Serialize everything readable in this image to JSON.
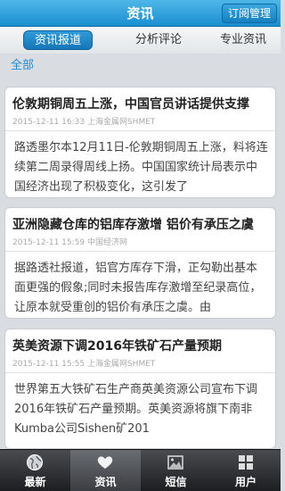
{
  "header": {
    "title": "资讯",
    "subscribe_label": "订阅管理"
  },
  "tabs": [
    {
      "label": "资讯报道",
      "active": true
    },
    {
      "label": "分析评论",
      "active": false
    },
    {
      "label": "专业资讯",
      "active": false
    }
  ],
  "section_label": "全部",
  "articles": [
    {
      "title": "伦敦期铜周五上涨，中国官员讲话提供支撑",
      "meta": "2015-12-11 16:33 上海金属网SHMET",
      "body": "路透墨尔本12月11日-伦敦期铜周五上涨，料将连续第二周录得周线上扬。中国国家统计局表示中国经济出现了积极变化，这引发了"
    },
    {
      "title": "亚洲隐藏仓库的铝库存激增 铝价有承压之虞",
      "meta": "2015-12-11 15:59 中国经济网",
      "body": "据路透社报道，铝官方库存下滑，正勾勒出基本面更强的假象;同时未报告库存激增至纪录高位，让原本就受重创的铝价有承压之虞。由"
    },
    {
      "title": "英美资源下调2016年铁矿石产量预期",
      "meta": "2015-12-11 15:55 上海金属网SHMET",
      "body": "世界第五大铁矿石生产商英美资源公司宣布下调2016年铁矿石产量预期。英美资源将旗下南非Kumba公司Sishen矿201"
    }
  ],
  "bottom_nav": [
    {
      "label": "最新",
      "icon": "globe-icon",
      "active": false
    },
    {
      "label": "资讯",
      "icon": "heart-icon",
      "active": true
    },
    {
      "label": "短信",
      "icon": "picture-icon",
      "active": false
    },
    {
      "label": "用户",
      "icon": "grid-icon",
      "active": false
    }
  ]
}
